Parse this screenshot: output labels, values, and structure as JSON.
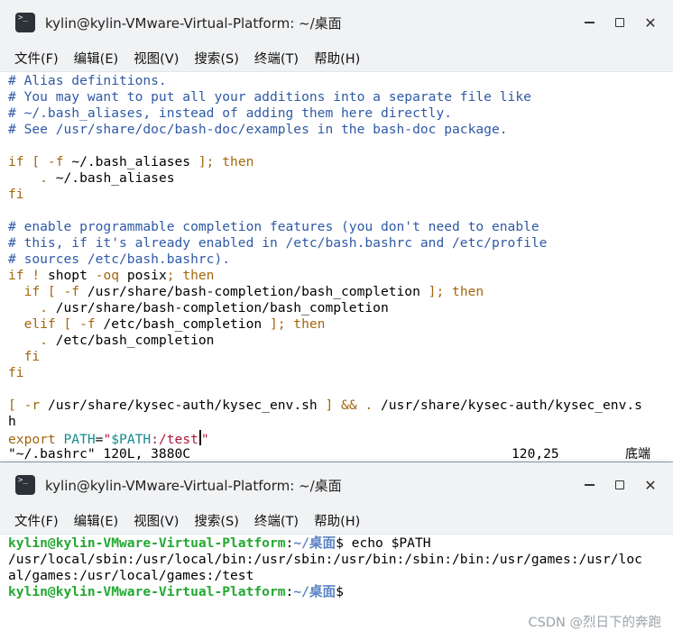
{
  "colors": {
    "comment": "#2f5aa6",
    "keyword": "#a3660c",
    "string": "#b0143c",
    "variable": "#148a8a",
    "prompt_user": "#23a832",
    "prompt_path": "#5a84c6"
  },
  "window1": {
    "icon": "terminal-icon",
    "title": "kylin@kylin-VMware-Virtual-Platform: ~/桌面",
    "menu": [
      "文件(F)",
      "编辑(E)",
      "视图(V)",
      "搜索(S)",
      "终端(T)",
      "帮助(H)"
    ],
    "code": {
      "l1": "# Alias definitions.",
      "l2": "# You may want to put all your additions into a separate file like",
      "l3": "# ~/.bash_aliases, instead of adding them here directly.",
      "l4": "# See /usr/share/doc/bash-doc/examples in the bash-doc package.",
      "l6a": "if [ -f",
      "l6b": " ~/.bash_aliases ",
      "l6c": "]; then",
      "l7a": "    .",
      "l7b": " ~/.bash_aliases",
      "l8": "fi",
      "l10": "# enable programmable completion features (you don't need to enable",
      "l11": "# this, if it's already enabled in /etc/bash.bashrc and /etc/profile",
      "l12": "# sources /etc/bash.bashrc).",
      "l13a": "if !",
      "l13b": " shopt ",
      "l13c": "-oq",
      "l13d": " posix",
      "l13e": "; then",
      "l14a": "  if [ -f",
      "l14b": " /usr/share/bash-completion/bash_completion ",
      "l14c": "]; then",
      "l15a": "    .",
      "l15b": " /usr/share/bash-completion/bash_completion",
      "l16a": "  elif [ -f",
      "l16b": " /etc/bash_completion ",
      "l16c": "]; then",
      "l17a": "    .",
      "l17b": " /etc/bash_completion",
      "l18": "  fi",
      "l19": "fi",
      "l21a": "[ -r",
      "l21b": " /usr/share/kysec-auth/kysec_env.sh ",
      "l21c": "] &&",
      "l21d": " ",
      "l21e": ".",
      "l21f": " /usr/share/kysec-auth/kysec_env.s",
      "l22": "h",
      "l23a": "export",
      "l23b": " PATH",
      "l23c": "=",
      "l23d": "\"",
      "l23e": "$PATH",
      "l23f": ":/test",
      "l23g": "\""
    },
    "status": {
      "file": "\"~/.bashrc\" 120L, 3880C",
      "position": "120,25",
      "location": "底端"
    }
  },
  "window2": {
    "icon": "terminal-icon",
    "title": "kylin@kylin-VMware-Virtual-Platform: ~/桌面",
    "menu": [
      "文件(F)",
      "编辑(E)",
      "视图(V)",
      "搜索(S)",
      "终端(T)",
      "帮助(H)"
    ],
    "prompt_user": "kylin@kylin-VMware-Virtual-Platform",
    "prompt_colon": ":",
    "prompt_path": "~/桌面",
    "prompt_symbol": "$",
    "command": " echo $PATH",
    "output1": "/usr/local/sbin:/usr/local/bin:/usr/sbin:/usr/bin:/sbin:/bin:/usr/games:/usr/loc",
    "output2": "al/games:/usr/local/games:/test"
  },
  "watermark": "CSDN @烈日下的奔跑"
}
